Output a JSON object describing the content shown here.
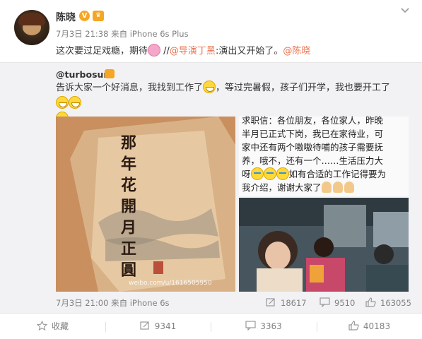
{
  "post": {
    "author": "陈晓",
    "meta": "7月3日 21:38 来自 iPhone 6s Plus",
    "text_plain": "这次要过足戏瘾，期待",
    "text_after": " //",
    "link1": "@导演丁黑",
    "text_mid": ":演出又开始了。",
    "link2": "@陈晓"
  },
  "repost": {
    "author": "@turbosun",
    "text_line1": "告诉大家一个好消息，我找到工作了",
    "text_line1b": "，等过完暑假，孩子们开学，我也要开工了",
    "image_text_lines": [
      "求职信：各位朋友，各位家人，昨晚",
      "半月已正式下岗，我已在家待业，可",
      "家中还有两个嗷嗷待哺的孩子需要抚",
      "养，哦不，还有一个……生活压力大",
      "呀",
      "如有合适的工作记得要为",
      "我介绍，谢谢大家了"
    ],
    "poster_title": "那年花開月正圓",
    "watermark": "weibo.com/u/1616505950",
    "meta": "7月3日 21:00 来自 iPhone 6s",
    "reposts": "18617",
    "comments": "9510",
    "likes": "163055"
  },
  "actions": {
    "favorite": "收藏",
    "repost": "9341",
    "comment": "3363",
    "like": "40183"
  },
  "colors": {
    "link": "#eb7350",
    "repost_bg": "#f2f2f5",
    "muted": "#808080"
  }
}
